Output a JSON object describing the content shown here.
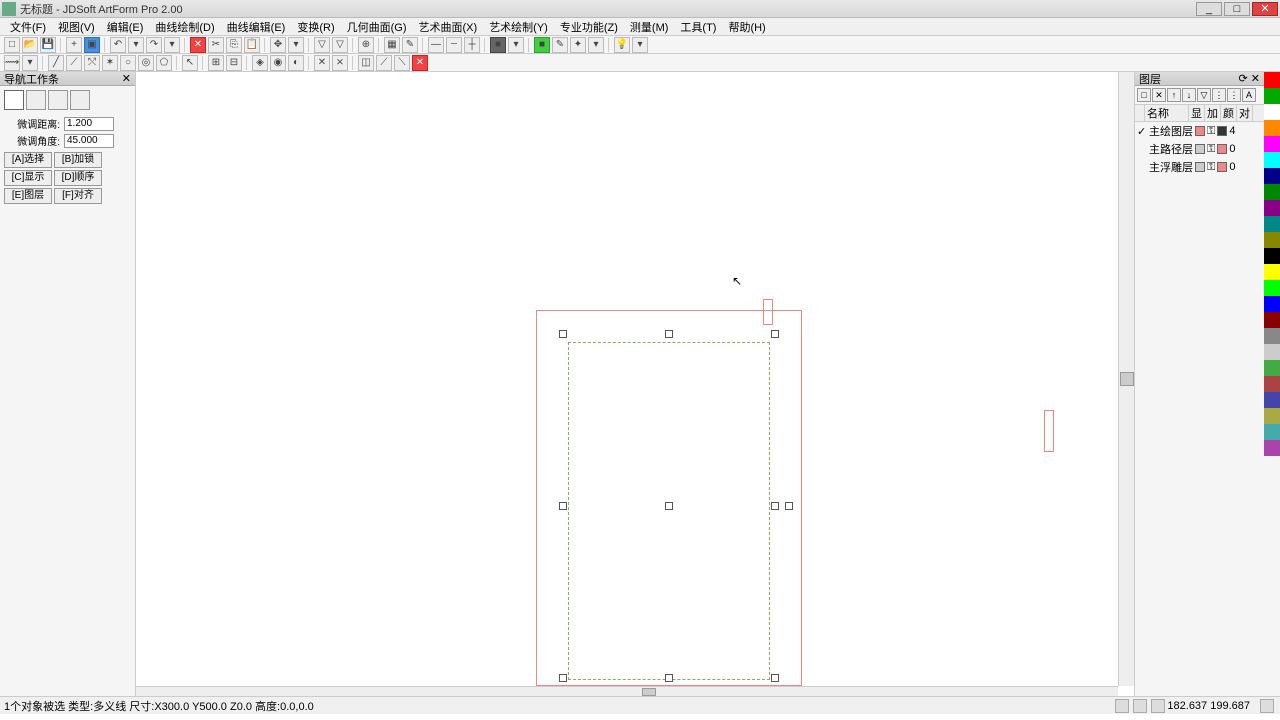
{
  "app": {
    "title": "无标题 - JDSoft ArtForm Pro 2.00"
  },
  "menu": [
    "文件(F)",
    "视图(V)",
    "编辑(E)",
    "曲线绘制(D)",
    "曲线编辑(E)",
    "变换(R)",
    "几何曲面(G)",
    "艺术曲面(X)",
    "艺术绘制(Y)",
    "专业功能(Z)",
    "测量(M)",
    "工具(T)",
    "帮助(H)"
  ],
  "left": {
    "title": "导航工作条",
    "dist_label": "微调距离:",
    "dist_value": "1.200",
    "angle_label": "微调角度:",
    "angle_value": "45.000",
    "buttons": [
      "[A]选择",
      "[B]加锁",
      "[C]显示",
      "[D]顺序",
      "[E]图层",
      "[F]对齐"
    ]
  },
  "layers": {
    "title": "图层",
    "col_name": "名称",
    "columns": [
      "显",
      "加",
      "颜",
      "对"
    ],
    "rows": [
      {
        "chk": "✓",
        "name": "主绘图层",
        "count": "4",
        "c1": "#e88",
        "c2": "#333"
      },
      {
        "chk": "",
        "name": "主路径层",
        "count": "0",
        "c1": "#ccc",
        "c2": "#e88"
      },
      {
        "chk": "",
        "name": "主浮雕层",
        "count": "0",
        "c1": "#ccc",
        "c2": "#e88"
      }
    ]
  },
  "colors": [
    "#f00",
    "#0a0",
    "#fff",
    "#f80",
    "#f0f",
    "#0ff",
    "#008",
    "#080",
    "#808",
    "#088",
    "#880",
    "#000",
    "#ff0",
    "#0f0",
    "#00f",
    "#800",
    "#888",
    "#ccc",
    "#4a4",
    "#a44",
    "#44a",
    "#aa4",
    "#4aa",
    "#a4a"
  ],
  "status": {
    "text": "1个对象被选 类型:多义线 尺寸:X300.0 Y500.0 Z0.0 高度:0.0,0.0",
    "coords": "182.637 199.687"
  }
}
